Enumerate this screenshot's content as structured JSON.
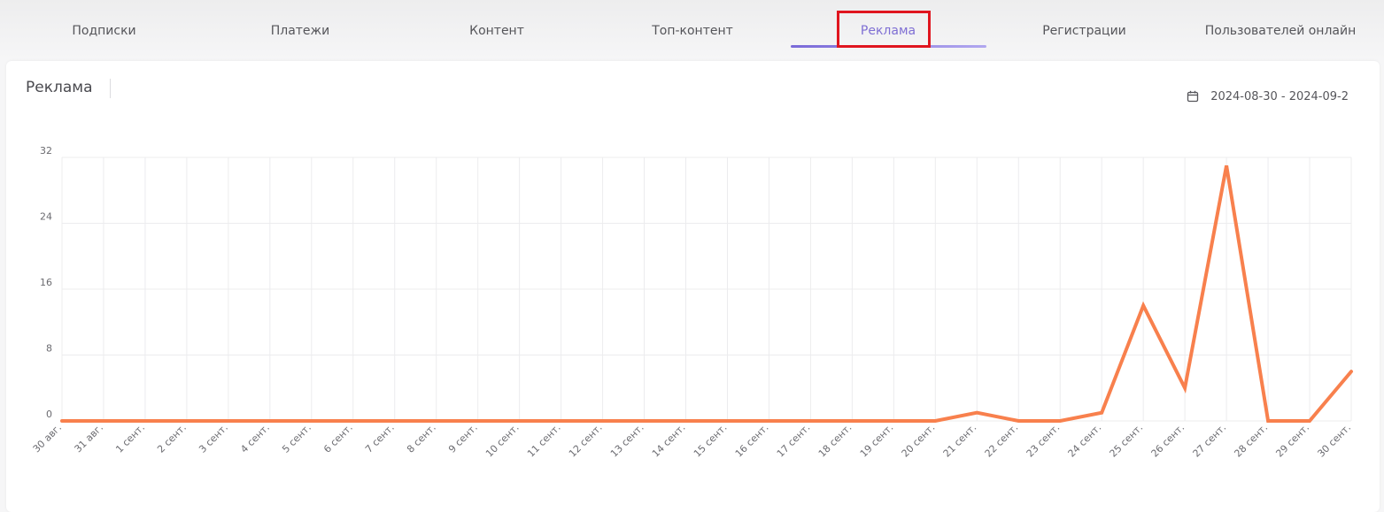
{
  "tabs": [
    {
      "label": "Подписки"
    },
    {
      "label": "Платежи"
    },
    {
      "label": "Контент"
    },
    {
      "label": "Топ-контент"
    },
    {
      "label": "Реклама",
      "active": true
    },
    {
      "label": "Регистрации"
    },
    {
      "label": "Пользователей онлайн"
    }
  ],
  "card": {
    "title": "Реклама",
    "date_range": "2024-08-30 - 2024-09-2",
    "date_icon": "calendar-icon"
  },
  "colors": {
    "accent": "#7f6fd4",
    "line": "#f8804d",
    "highlight": "#e0151f"
  },
  "chart_data": {
    "type": "line",
    "categories": [
      "30 авг.",
      "31 авг.",
      "1 сент.",
      "2 сент.",
      "3 сент.",
      "4 сент.",
      "5 сент.",
      "6 сент.",
      "7 сент.",
      "8 сент.",
      "9 сент.",
      "10 сент.",
      "11 сент.",
      "12 сент.",
      "13 сент.",
      "14 сент.",
      "15 сент.",
      "16 сент.",
      "17 сент.",
      "18 сент.",
      "19 сент.",
      "20 сент.",
      "21 сент.",
      "22 сент.",
      "23 сент.",
      "24 сент.",
      "25 сент.",
      "26 сент.",
      "27 сент.",
      "28 сент.",
      "29 сент.",
      "30 сент."
    ],
    "values": [
      0,
      0,
      0,
      0,
      0,
      0,
      0,
      0,
      0,
      0,
      0,
      0,
      0,
      0,
      0,
      0,
      0,
      0,
      0,
      0,
      0,
      0,
      1,
      0,
      0,
      1,
      14,
      4,
      31,
      0,
      0,
      6
    ],
    "yticks": [
      0,
      8,
      16,
      24,
      32
    ],
    "ylim": [
      0,
      32
    ],
    "grid": true,
    "legend": "none"
  }
}
